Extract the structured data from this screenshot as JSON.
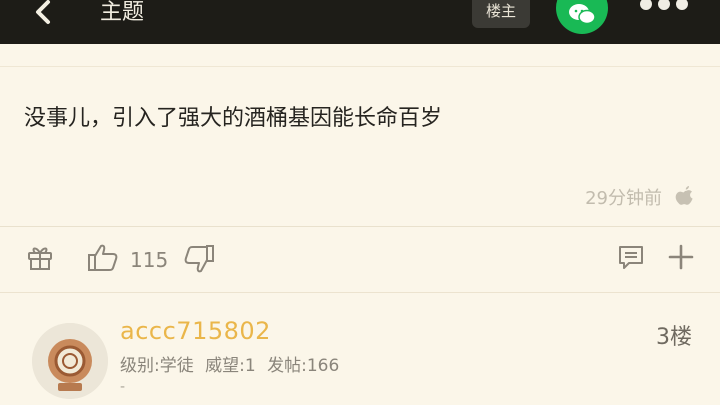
{
  "header": {
    "back_icon": "chevron-left-icon",
    "title": "主题",
    "owner_label": "楼主",
    "share_icon": "wechat-icon",
    "more_icon": "more-horizontal-icon"
  },
  "post": {
    "text": "没事儿，引入了强大的酒桶基因能长命百岁",
    "time": "29分钟前",
    "platform_icon": "apple-icon",
    "likes": "115",
    "actions": {
      "gift_icon": "gift-icon",
      "like_icon": "thumbs-up-icon",
      "dislike_icon": "thumbs-down-icon",
      "comment_icon": "comment-icon",
      "add_icon": "plus-icon"
    }
  },
  "next_post": {
    "username": "accc715802",
    "floor": "3楼",
    "level": "级别:学徒",
    "prestige": "威望:1",
    "posts": "发帖:166",
    "extra": "-"
  },
  "colors": {
    "topbar": "#1d1c17",
    "background": "#fbf6e9",
    "wechat": "#19b955",
    "username": "#eab64a"
  }
}
